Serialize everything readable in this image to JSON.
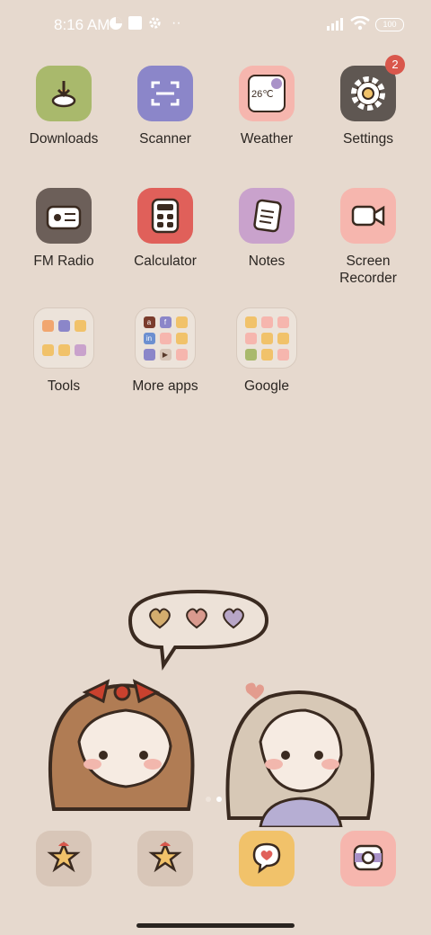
{
  "status_bar": {
    "time": "8:16 AM",
    "battery": "100"
  },
  "apps_row1": [
    {
      "label": "Downloads",
      "icon": "download-icon",
      "color": "#a9b96c"
    },
    {
      "label": "Scanner",
      "icon": "scanner-icon",
      "color": "#8b86c9"
    },
    {
      "label": "Weather",
      "icon": "weather-icon",
      "color": "#f6b6ae",
      "temp": "26℃"
    },
    {
      "label": "Settings",
      "icon": "gear-icon",
      "color": "#5f5752",
      "badge": "2"
    }
  ],
  "apps_row2": [
    {
      "label": "FM Radio",
      "icon": "radio-icon",
      "color": "#6c5f59"
    },
    {
      "label": "Calculator",
      "icon": "calculator-icon",
      "color": "#e0605a"
    },
    {
      "label": "Notes",
      "icon": "notes-icon",
      "color": "#c9a2cc"
    },
    {
      "label": "Screen\nRecorder",
      "icon": "video-camera-icon",
      "color": "#f6b6ae"
    }
  ],
  "folders": [
    {
      "label": "Tools"
    },
    {
      "label": "More apps"
    },
    {
      "label": "Google"
    }
  ],
  "dock": [
    {
      "icon": "star-icon",
      "color": "#d8c6b8"
    },
    {
      "icon": "star-icon",
      "color": "#d8c6b8"
    },
    {
      "icon": "chat-heart-icon",
      "color": "#f1c26a"
    },
    {
      "icon": "camera-icon",
      "color": "#f6b6ae"
    }
  ],
  "colors": {
    "background": "#e6d9ce",
    "badge": "#d9574c"
  }
}
